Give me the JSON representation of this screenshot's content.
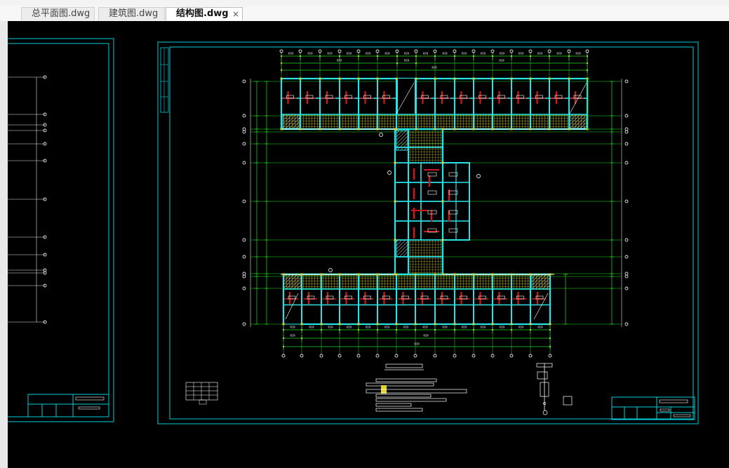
{
  "tabs": [
    {
      "label": "总平面图.dwg",
      "active": false
    },
    {
      "label": "建筑图.dwg",
      "active": false
    },
    {
      "label": "结构图.dwg",
      "active": true
    }
  ],
  "close_glyph": "×",
  "colors": {
    "background": "#000000",
    "frame": "#00cfd8",
    "column": "#27e3e6",
    "axis": "#e6e6e6",
    "grid": "#22dd22",
    "beam": "#d01818",
    "hatch": "#e2d22a",
    "text": "#ffffff"
  }
}
